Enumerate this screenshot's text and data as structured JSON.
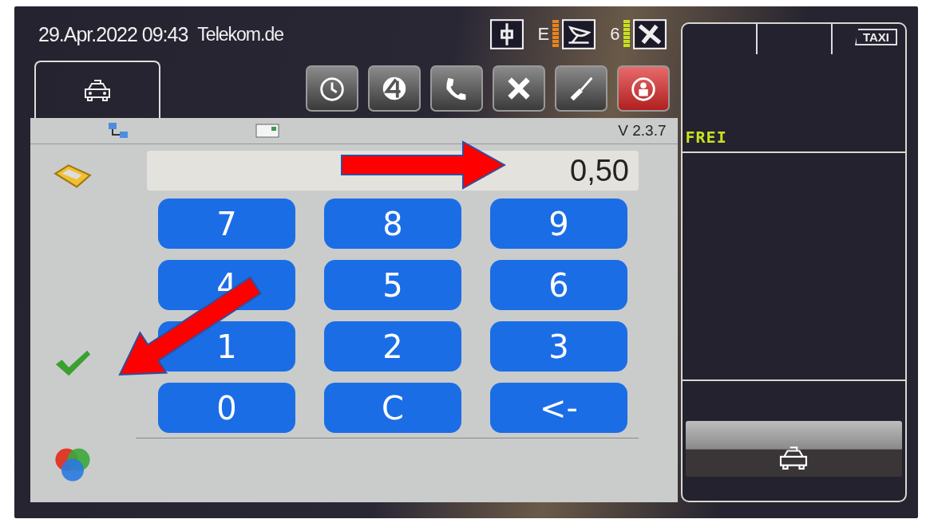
{
  "status_bar": {
    "datetime": "29.Apr.2022 09:43",
    "network": "Telekom.de",
    "gsm_indicator": "E",
    "satellite_count": "6"
  },
  "panel": {
    "version": "V 2.3.7",
    "amount": "0,50",
    "keys": [
      "7",
      "8",
      "9",
      "4",
      "5",
      "6",
      "1",
      "2",
      "3",
      "0",
      "C",
      "<-"
    ]
  },
  "meter": {
    "status": "FREI",
    "roof_sign": "TAXI"
  }
}
